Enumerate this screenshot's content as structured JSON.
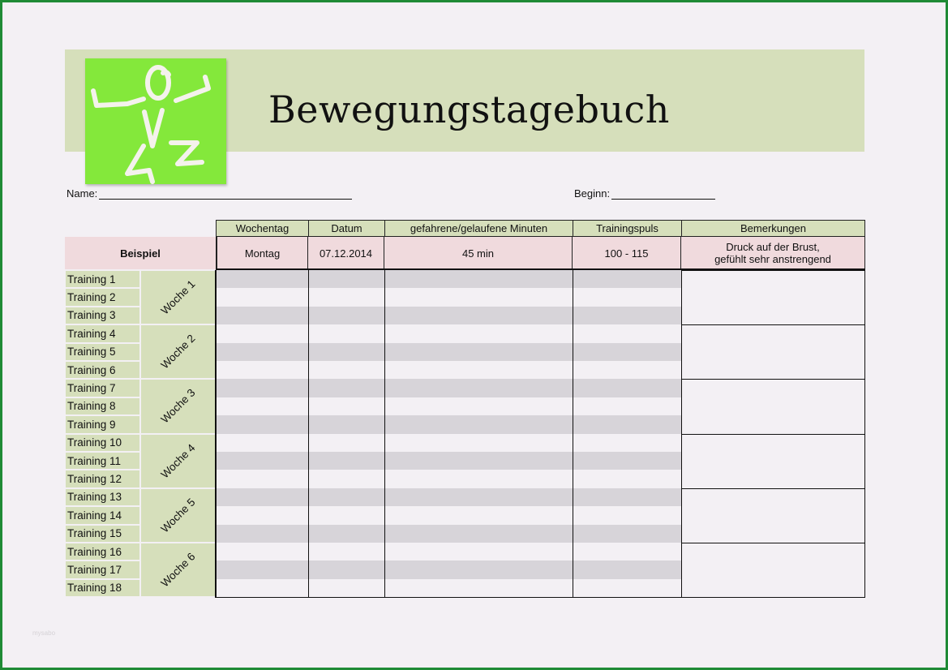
{
  "title": "Bewegungstagebuch",
  "logo_icon": "jumping-figure-icon",
  "fields": {
    "name_label": "Name:",
    "name_value": "",
    "begin_label": "Beginn:",
    "begin_value": ""
  },
  "table": {
    "headers": [
      "Wochentag",
      "Datum",
      "gefahrene/gelaufene Minuten",
      "Trainingspuls",
      "Bemerkungen"
    ],
    "example": {
      "label": "Beispiel",
      "values": [
        "Montag",
        "07.12.2014",
        "45 min",
        "100 - 115"
      ],
      "remark_line1": "Druck auf der Brust,",
      "remark_line2": "gefühlt sehr anstrengend"
    },
    "rows": [
      "Training 1",
      "Training 2",
      "Training 3",
      "Training 4",
      "Training 5",
      "Training 6",
      "Training 7",
      "Training 8",
      "Training 9",
      "Training 10",
      "Training 11",
      "Training 12",
      "Training 13",
      "Training 14",
      "Training 15",
      "Training 16",
      "Training 17",
      "Training 18"
    ],
    "weeks": [
      "Woche 1",
      "Woche 2",
      "Woche 3",
      "Woche 4",
      "Woche 5",
      "Woche 6"
    ]
  },
  "colors": {
    "frame": "#1f8a35",
    "header_band": "#d6dfbb",
    "logo": "#84e83b",
    "example_row": "#f0dadd",
    "stripe": "#d7d4d9"
  },
  "watermark": "mysabo"
}
